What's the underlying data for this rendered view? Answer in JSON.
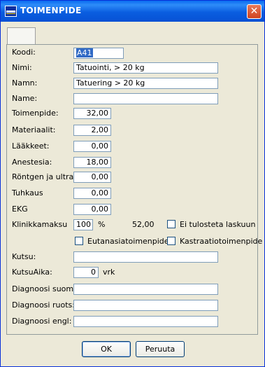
{
  "window": {
    "title": "TOIMENPIDE",
    "close_label": "✕"
  },
  "tab": {
    "label": ""
  },
  "fields": {
    "koodi": {
      "label": "Koodi:",
      "value": "A41"
    },
    "nimi": {
      "label": "Nimi:",
      "value": "Tatuointi, > 20 kg"
    },
    "namn": {
      "label": "Namn:",
      "value": "Tatuering > 20 kg"
    },
    "name": {
      "label": "Name:",
      "value": ""
    },
    "toimenpide": {
      "label": "Toimenpide:",
      "value": "32,00"
    },
    "materiaalit": {
      "label": "Materiaalit:",
      "value": "2,00"
    },
    "laakkeet": {
      "label": "Lääkkeet:",
      "value": "0,00"
    },
    "anestesia": {
      "label": "Anestesia:",
      "value": "18,00"
    },
    "rontgen": {
      "label": "Röntgen ja ultraä",
      "value": "0,00"
    },
    "tuhkaus": {
      "label": "Tuhkaus",
      "value": "0,00"
    },
    "ekg": {
      "label": "EKG",
      "value": "0,00"
    },
    "klinikkamaksu": {
      "label": "Klinikkamaksu",
      "value": "100",
      "unit": "%",
      "amount": "52,00"
    },
    "kutsu": {
      "label": "Kutsu:",
      "value": ""
    },
    "kutsuaika": {
      "label": "KutsuAika:",
      "value": "0",
      "unit": "vrk"
    },
    "diagnoosi_suom": {
      "label": "Diagnoosi suom:",
      "value": ""
    },
    "diagnoosi_ruots": {
      "label": "Diagnoosi ruots:",
      "value": ""
    },
    "diagnoosi_engl": {
      "label": "Diagnoosi engl:",
      "value": ""
    }
  },
  "checkboxes": {
    "ei_tulosteta": {
      "label": "Ei tulosteta laskuun",
      "checked": false
    },
    "eutanasia": {
      "label": "Eutanasiatoimenpide",
      "checked": false
    },
    "kastraatio": {
      "label": "Kastraatiotoimenpide",
      "checked": false
    }
  },
  "buttons": {
    "ok": "OK",
    "cancel": "Peruuta"
  }
}
